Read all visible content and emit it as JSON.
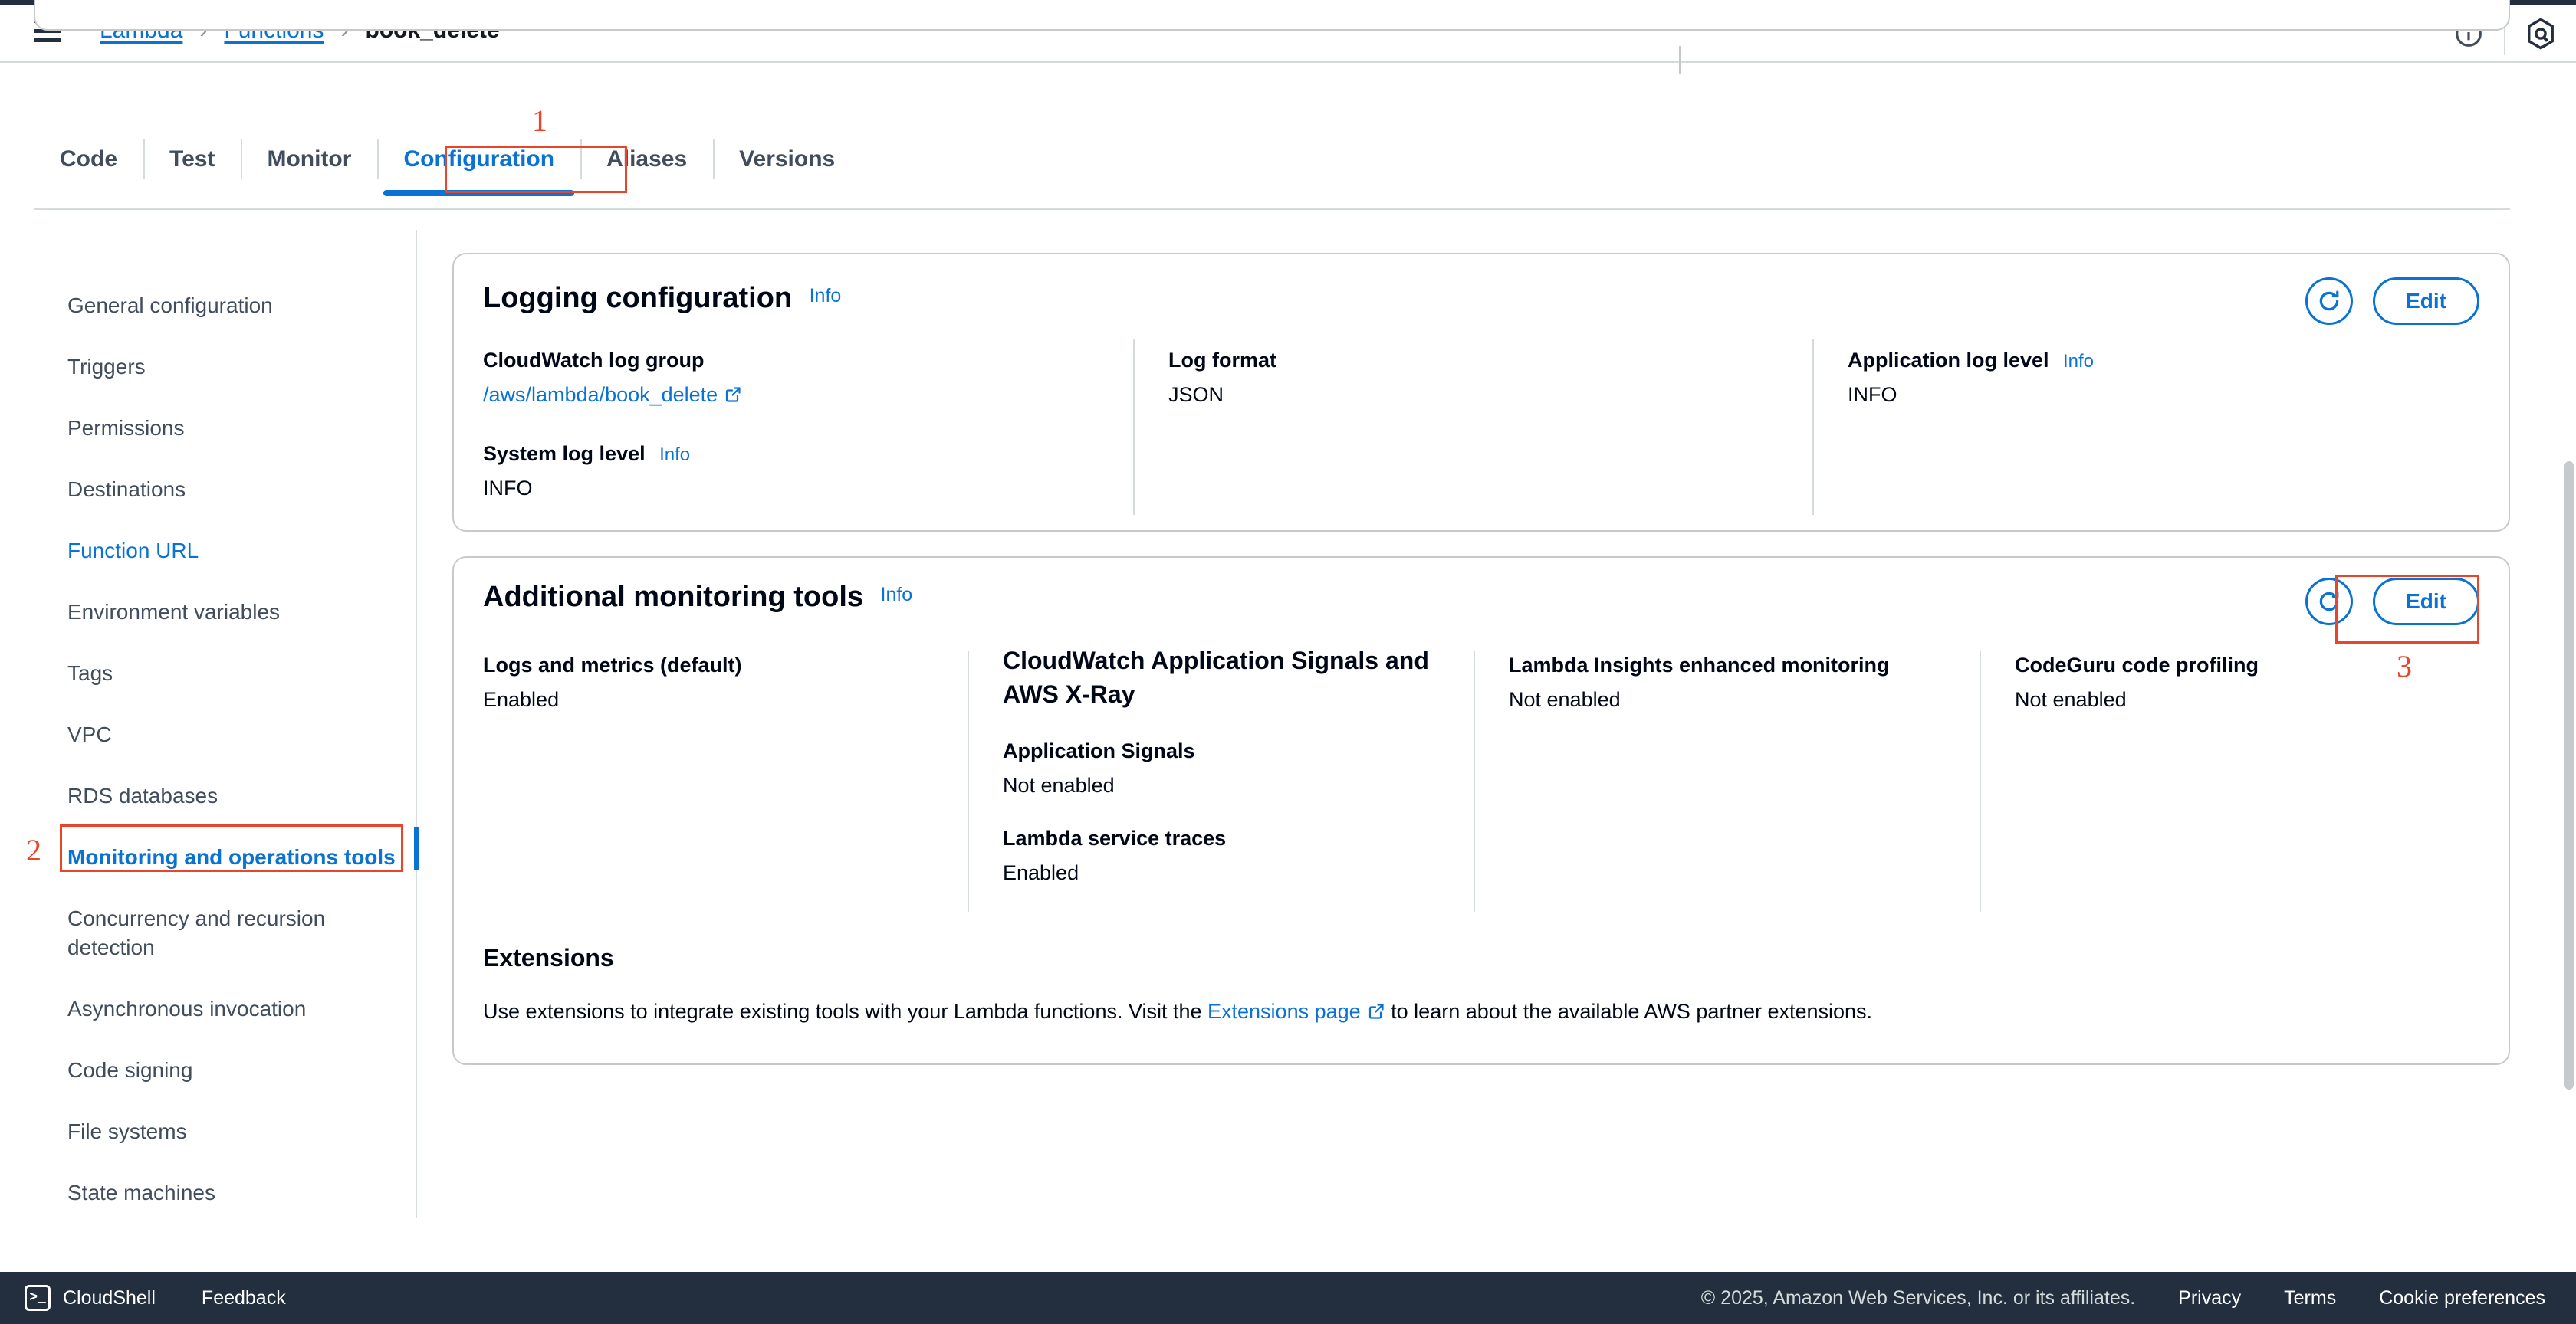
{
  "topnav": {
    "menu_icon": "hamburger-menu-icon",
    "breadcrumb": {
      "items": [
        {
          "label": "Lambda",
          "type": "link"
        },
        {
          "label": "Functions",
          "type": "link"
        },
        {
          "label": "book_delete",
          "type": "current"
        }
      ],
      "separator": "›"
    },
    "info_icon": "info-circle-icon",
    "assistant_icon": "amazon-q-hexagon-icon"
  },
  "tabs": [
    {
      "label": "Code",
      "active": false
    },
    {
      "label": "Test",
      "active": false
    },
    {
      "label": "Monitor",
      "active": false
    },
    {
      "label": "Configuration",
      "active": true
    },
    {
      "label": "Aliases",
      "active": false
    },
    {
      "label": "Versions",
      "active": false
    }
  ],
  "sidebar": {
    "items": [
      {
        "label": "General configuration",
        "state": "default"
      },
      {
        "label": "Triggers",
        "state": "default"
      },
      {
        "label": "Permissions",
        "state": "default"
      },
      {
        "label": "Destinations",
        "state": "default"
      },
      {
        "label": "Function URL",
        "state": "link"
      },
      {
        "label": "Environment variables",
        "state": "default"
      },
      {
        "label": "Tags",
        "state": "default"
      },
      {
        "label": "VPC",
        "state": "default"
      },
      {
        "label": "RDS databases",
        "state": "default"
      },
      {
        "label": "Monitoring and operations tools",
        "state": "selected"
      },
      {
        "label": "Concurrency and recursion detection",
        "state": "default"
      },
      {
        "label": "Asynchronous invocation",
        "state": "default"
      },
      {
        "label": "Code signing",
        "state": "default"
      },
      {
        "label": "File systems",
        "state": "default"
      },
      {
        "label": "State machines",
        "state": "default"
      }
    ]
  },
  "logging_card": {
    "title": "Logging configuration",
    "info_label": "Info",
    "refresh_icon": "refresh-circle-icon",
    "edit_label": "Edit",
    "fields": {
      "log_group_label": "CloudWatch log group",
      "log_group_value": "/aws/lambda/book_delete",
      "log_group_external_icon": "external-link-icon",
      "system_log_level_label": "System log level",
      "system_log_level_info": "Info",
      "system_log_level_value": "INFO",
      "log_format_label": "Log format",
      "log_format_value": "JSON",
      "app_log_level_label": "Application log level",
      "app_log_level_info": "Info",
      "app_log_level_value": "INFO"
    }
  },
  "monitoring_card": {
    "title": "Additional monitoring tools",
    "info_label": "Info",
    "refresh_icon": "refresh-circle-icon",
    "edit_label": "Edit",
    "columns": {
      "logs_metrics_label": "Logs and metrics (default)",
      "logs_metrics_value": "Enabled",
      "app_signals_heading": "CloudWatch Application Signals and AWS X-Ray",
      "app_signals_label": "Application Signals",
      "app_signals_value": "Not enabled",
      "service_traces_label": "Lambda service traces",
      "service_traces_value": "Enabled",
      "insights_label": "Lambda Insights enhanced monitoring",
      "insights_value": "Not enabled",
      "codeguru_label": "CodeGuru code profiling",
      "codeguru_value": "Not enabled"
    },
    "extensions": {
      "heading": "Extensions",
      "text_before": "Use extensions to integrate existing tools with your Lambda functions. Visit the ",
      "link_label": "Extensions page",
      "link_external_icon": "external-link-icon",
      "text_after": " to learn about the available AWS partner extensions."
    }
  },
  "annotations": [
    {
      "number": "1",
      "target": "configuration-tab"
    },
    {
      "number": "2",
      "target": "monitoring-and-operations-tools-sidebar-item"
    },
    {
      "number": "3",
      "target": "additional-monitoring-tools-edit-button"
    }
  ],
  "footer": {
    "cloudshell_label": "CloudShell",
    "cloudshell_icon": "cloudshell-terminal-icon",
    "feedback_label": "Feedback",
    "copyright": "© 2025, Amazon Web Services, Inc. or its affiliates.",
    "links": [
      "Privacy",
      "Terms",
      "Cookie preferences"
    ]
  },
  "colors": {
    "aws_blue": "#0972d3",
    "annotation_red": "#e8452a",
    "footer_dark": "#232f3e",
    "border_gray": "#c6cacd"
  }
}
